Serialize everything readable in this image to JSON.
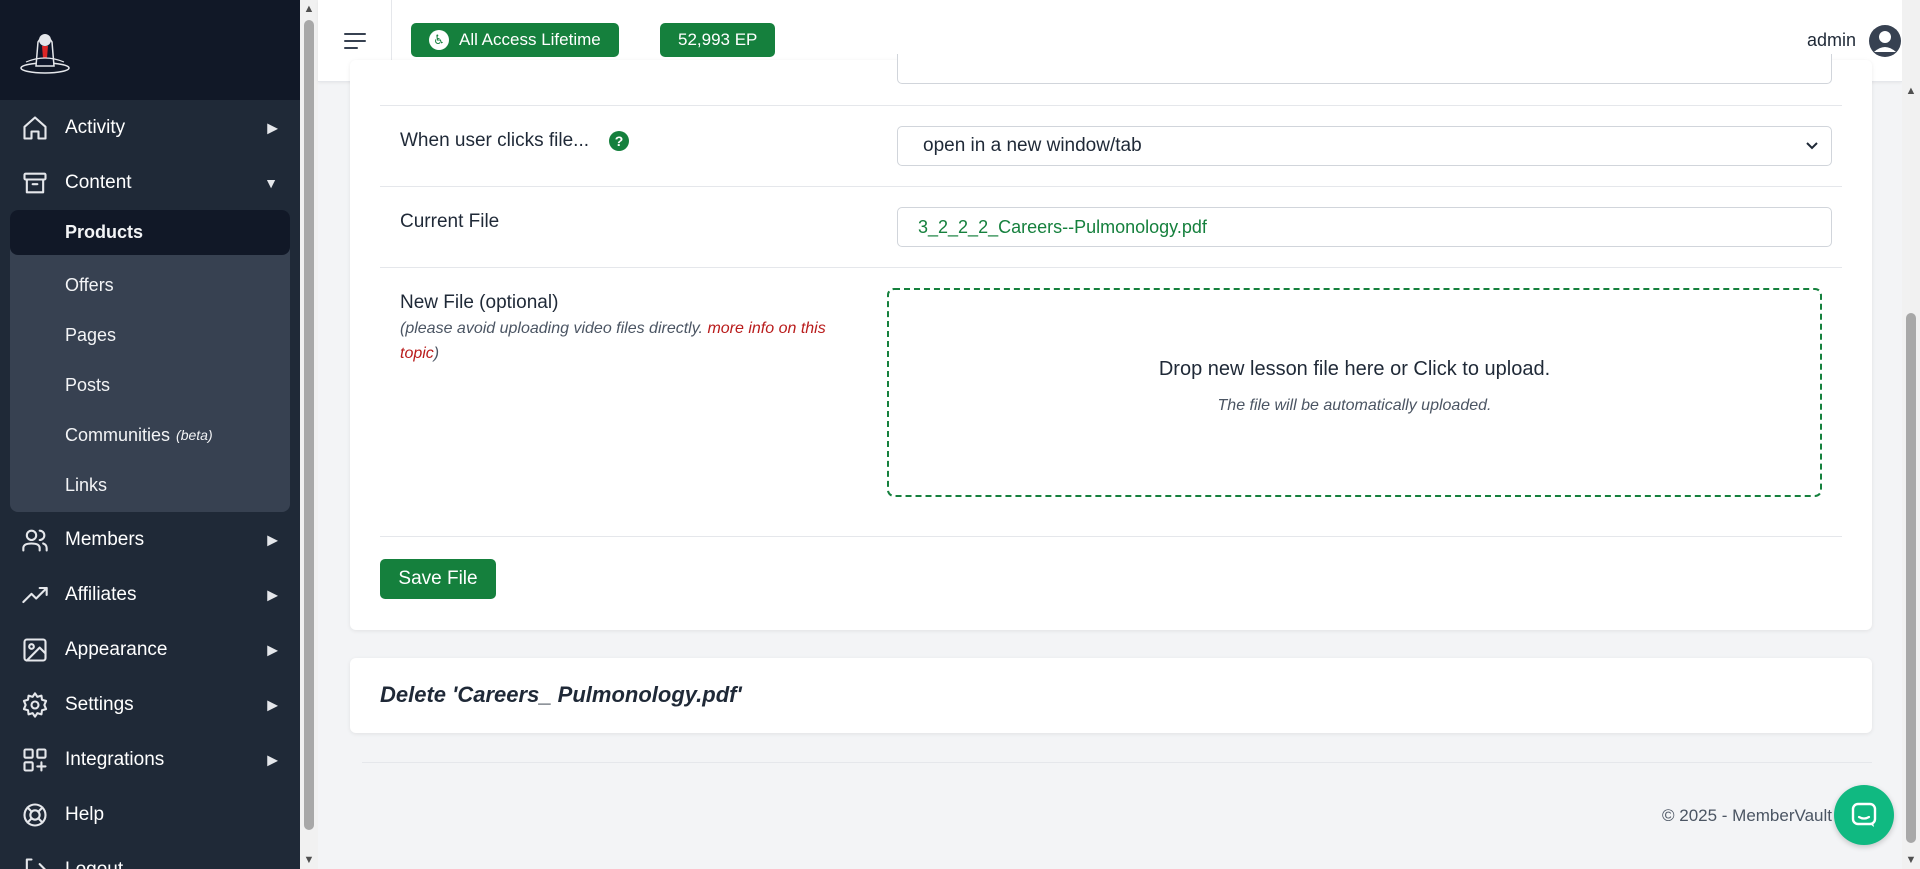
{
  "sidebar": {
    "logo_icon": "brand-logo",
    "items": [
      {
        "label": "Activity",
        "icon": "home-icon",
        "caret": "▶"
      },
      {
        "label": "Content",
        "icon": "archive-icon",
        "caret": "▼"
      },
      {
        "label": "Members",
        "icon": "users-icon",
        "caret": "▶"
      },
      {
        "label": "Affiliates",
        "icon": "trending-icon",
        "caret": "▶"
      },
      {
        "label": "Appearance",
        "icon": "image-icon",
        "caret": "▶"
      },
      {
        "label": "Settings",
        "icon": "gear-icon",
        "caret": "▶"
      },
      {
        "label": "Integrations",
        "icon": "grid-plus-icon",
        "caret": "▶"
      },
      {
        "label": "Help",
        "icon": "lifebuoy-icon"
      },
      {
        "label": "Logout",
        "icon": "logout-icon"
      }
    ],
    "content_sub": [
      {
        "label": "Products"
      },
      {
        "label": "Offers"
      },
      {
        "label": "Pages"
      },
      {
        "label": "Posts"
      },
      {
        "label": "Communities",
        "badge": "(beta)"
      },
      {
        "label": "Links"
      }
    ]
  },
  "topbar": {
    "access_pill": "All Access Lifetime",
    "ep_pill": "52,993 EP",
    "user_name": "admin"
  },
  "form": {
    "click_label": "When user clicks file...",
    "help_mark": "?",
    "click_value": "open in a new window/tab",
    "current_label": "Current File",
    "current_value": "3_2_2_2_Careers--Pulmonology.pdf",
    "new_label": "New File (optional)",
    "new_note_pre": "(please avoid uploading video files directly.",
    "new_note_link": "more info on this topic",
    "new_note_post": ")",
    "drop_title": "Drop new lesson file here or Click to upload.",
    "drop_sub": "The file will be automatically uploaded.",
    "save_label": "Save File"
  },
  "delete_card": {
    "title": "Delete 'Careers_ Pulmonology.pdf'"
  },
  "footer": {
    "copyright": "© 2025 - MemberVault"
  },
  "colors": {
    "brand_green": "#15803d",
    "sidebar_bg": "#1f2937",
    "link_red": "#b91c1c",
    "chat_green": "#10b981"
  }
}
